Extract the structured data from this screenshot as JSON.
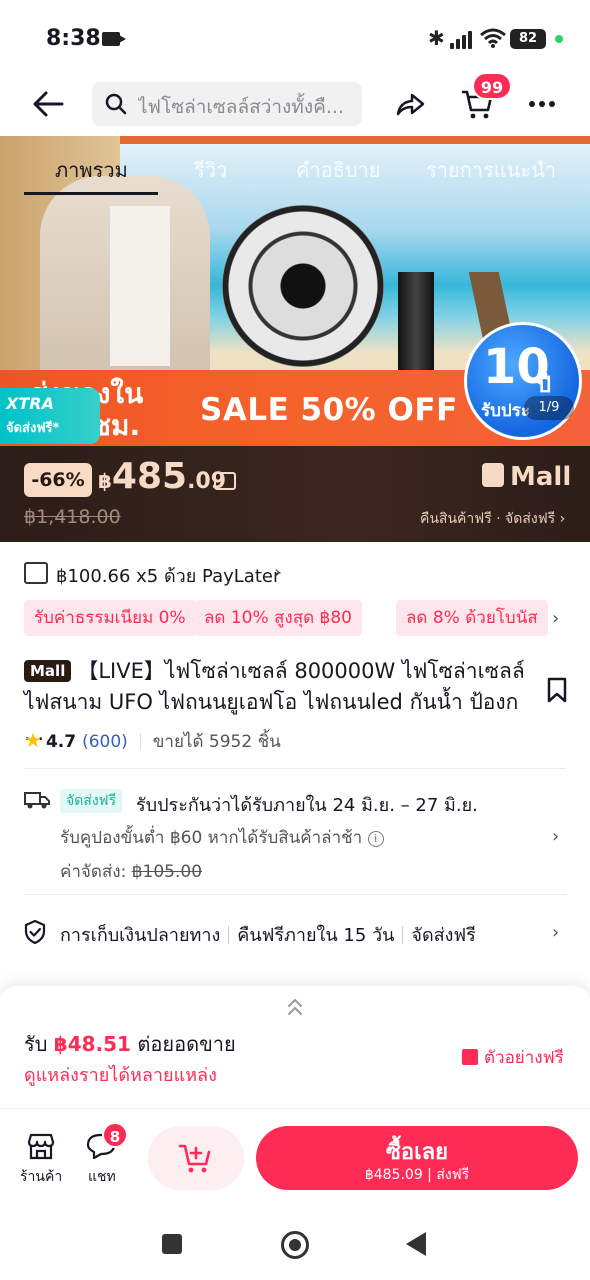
{
  "status": {
    "time": "8:38",
    "battery": "82",
    "bluetooth": "✱"
  },
  "nav": {
    "search_placeholder": "ไฟโซล่าเซลล์สว่างทั้งคื...",
    "cart_count": "99"
  },
  "tabs": [
    {
      "label": "ภาพรวม",
      "active": true
    },
    {
      "label": "รีวิว",
      "active": false
    },
    {
      "label": "คำอธิบาย",
      "active": false
    },
    {
      "label": "รายการแนะนำ",
      "active": false
    }
  ],
  "hero": {
    "promo_left_1": "ส่งของใน",
    "promo_left_2": "ชม.",
    "sale_text": "SALE 50% OFF",
    "xtra_title": "XTRA",
    "xtra_sub": "จัดส่งฟรี*",
    "badge_number": "10",
    "badge_unit": "ปี",
    "badge_sub": "รับประ",
    "image_counter": "1/9"
  },
  "price": {
    "discount": "-66%",
    "currency": "฿",
    "main": "485",
    "decimal": ".09",
    "original": "฿1,418.00",
    "mall_label": "Mall",
    "mall_sub": "คืนสินค้าฟรี · จัดส่งฟรี ›"
  },
  "paylater": {
    "text": "฿100.66 x5 ด้วย PayLater",
    "chevron": "›"
  },
  "chips": [
    "รับค่าธรรมเนียม 0%",
    "ลด 10% สูงสุด ฿80",
    "ลด 8% ด้วยโบนัส"
  ],
  "product": {
    "mall_tag": "Mall",
    "title": "【LIVE】ไฟโซล่าเซลล์ 800000W ไฟโซล่าเซลล์ ไฟสนาม UFO ไฟถนนยูเอฟโอ ไฟถนนled กันน้ำ ป้องก ...",
    "rating": "4.7",
    "review_count": "(600)",
    "sold": "ขายได้ 5952 ชิ้น"
  },
  "shipping": {
    "tag": "จัดส่งฟรี",
    "main": "รับประกันว่าได้รับภายใน 24 มิ.ย. – 27 มิ.ย.",
    "coupon": "รับคูปองขั้นต่ำ ฿60 หากได้รับสินค้าล่าช้า",
    "fee_label": "ค่าจัดส่ง:",
    "fee_value": "฿105.00"
  },
  "services": [
    "การเก็บเงินปลายทาง",
    "คืนฟรีภายใน 15 วัน",
    "จัดส่งฟรี"
  ],
  "affiliate": {
    "earn_prefix": "รับ",
    "earn_amount": "฿48.51",
    "earn_suffix": "ต่อยอดขาย",
    "sub": "ดูแหล่งรายได้หลายแหล่ง",
    "sample": "ตัวอย่างฟรี"
  },
  "actions": {
    "store_label": "ร้านค้า",
    "chat_label": "แชท",
    "chat_badge": "8",
    "buy_label": "ซื้อเลย",
    "buy_sub": "฿485.09 | ส่งฟรี"
  },
  "colors": {
    "accent": "#fe2c55",
    "price_bg": "#2c1d18",
    "price_text": "#f6dac3",
    "free_ship": "#1bb19a"
  }
}
